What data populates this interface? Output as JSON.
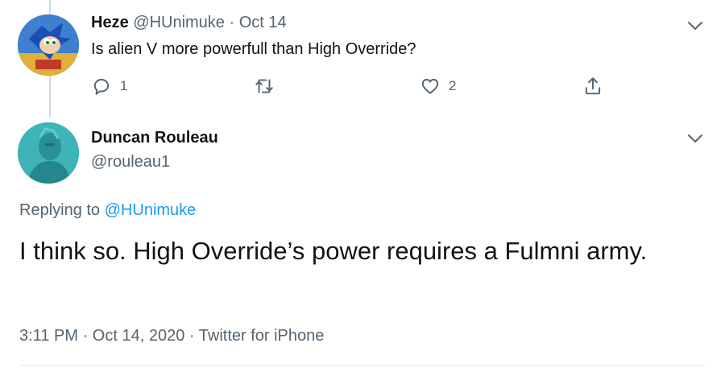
{
  "parent_tweet": {
    "display_name": "Heze",
    "handle": "@HUnimuke",
    "separator": "·",
    "date": "Oct 14",
    "text": "Is alien V more powerfull than High Override?",
    "reply_count": "1",
    "retweet_count": "",
    "like_count": "2",
    "avatar_icon": "sonic-avatar-icon"
  },
  "main_tweet": {
    "display_name": "Duncan Rouleau",
    "handle": "@rouleau1",
    "replying_prefix": "Replying to",
    "replying_handle": "@HUnimuke",
    "text": "I think so. High Override’s power requires a Fulmni army.",
    "time": "3:11 PM",
    "separator": "·",
    "date": "Oct 14, 2020",
    "client": "Twitter for iPhone",
    "avatar_icon": "portrait-avatar-icon"
  },
  "colors": {
    "link": "#1d9bf0",
    "secondary_text": "#536471",
    "primary_text": "#0f1419",
    "thread_line": "#cfd9de"
  }
}
